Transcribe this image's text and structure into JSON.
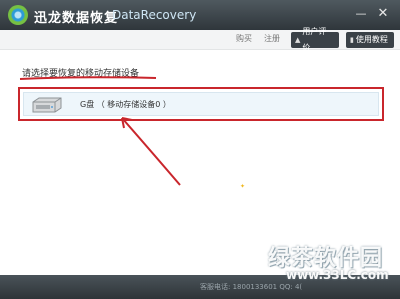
{
  "titlebar": {
    "app_name": "迅龙数据恢复",
    "subtitle": "DataRecovery",
    "minimize_glyph": "—",
    "close_glyph": "✕"
  },
  "toolbar": {
    "buy_label": "购买",
    "register_label": "注册",
    "review_label": "用户评价",
    "tutorial_label": "使用教程",
    "review_icon": "thumbs-up-icon",
    "tutorial_icon": "book-icon"
  },
  "main": {
    "prompt": "请选择要恢复的移动存储设备",
    "device": {
      "label": "G盘 （ 移动存储设备0 ）",
      "icon": "drive-icon"
    }
  },
  "statusbar": {
    "text": "客服电话: 1800133601 QQ: 4("
  },
  "watermark": {
    "main": "绿茶软件园",
    "url": "www.33LC.com"
  },
  "colors": {
    "highlight_red": "#c9262c",
    "titlebar_dark": "#2f363b",
    "device_bg": "#eef6fb"
  }
}
